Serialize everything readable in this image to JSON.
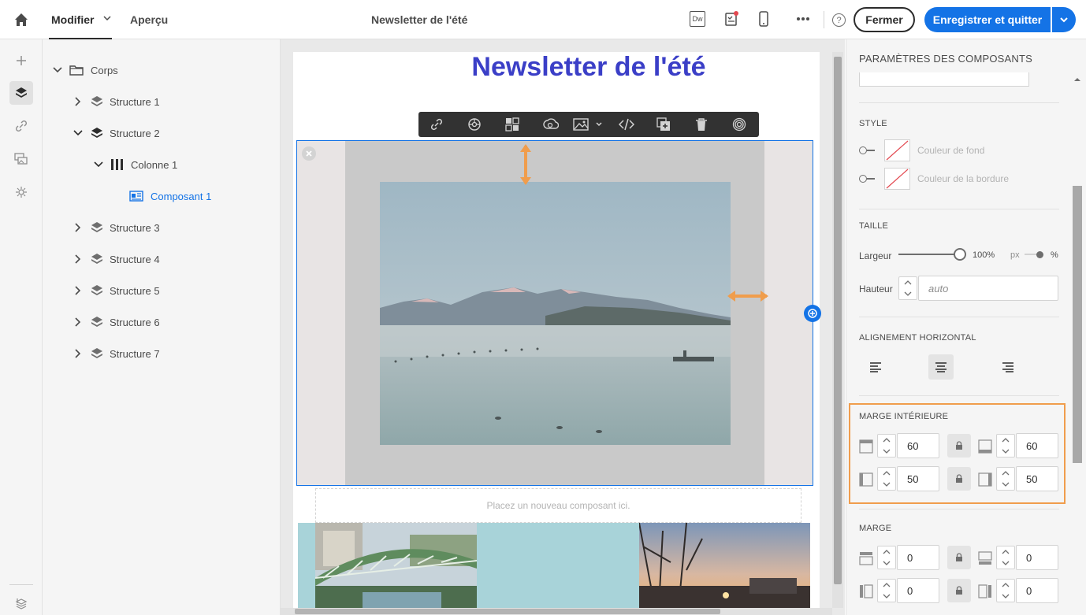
{
  "topbar": {
    "tab_edit": "Modifier",
    "tab_preview": "Aperçu",
    "doc_title": "Newsletter de l'été",
    "close_label": "Fermer",
    "save_label": "Enregistrer et quitter",
    "dw_label": "Dw",
    "help_label": "?"
  },
  "tree": {
    "root": "Corps",
    "items": [
      {
        "label": "Structure 1"
      },
      {
        "label": "Structure 2"
      },
      {
        "label": "Colonne 1"
      },
      {
        "label": "Composant 1"
      },
      {
        "label": "Structure 3"
      },
      {
        "label": "Structure 4"
      },
      {
        "label": "Structure 5"
      },
      {
        "label": "Structure 6"
      },
      {
        "label": "Structure 7"
      }
    ]
  },
  "canvas": {
    "email_title": "Newsletter de l'été",
    "drop_placeholder": "Placez un nouveau composant ici."
  },
  "panel": {
    "header": "PARAMÈTRES DES COMPOSANTS",
    "style": {
      "title": "STYLE",
      "bg_color_label": "Couleur de fond",
      "border_color_label": "Couleur de la bordure"
    },
    "size": {
      "title": "TAILLE",
      "width_label": "Largeur",
      "width_value": "100%",
      "unit_px": "px",
      "unit_pct": "%",
      "width_fraction": 1.0,
      "height_label": "Hauteur",
      "height_placeholder": "auto"
    },
    "align": {
      "title": "ALIGNEMENT HORIZONTAL",
      "selected": "center"
    },
    "padding": {
      "title": "MARGE INTÉRIEURE",
      "top": "60",
      "bottom": "60",
      "left": "50",
      "right": "50"
    },
    "margin": {
      "title": "MARGE",
      "top": "0",
      "bottom": "0",
      "left": "0",
      "right": "0"
    }
  },
  "colors": {
    "accent": "#1473e6",
    "highlight": "#f09d4c",
    "toolbar_bg": "#323232",
    "title_color": "#3b3fc7",
    "selection_border": "#1473e6"
  }
}
